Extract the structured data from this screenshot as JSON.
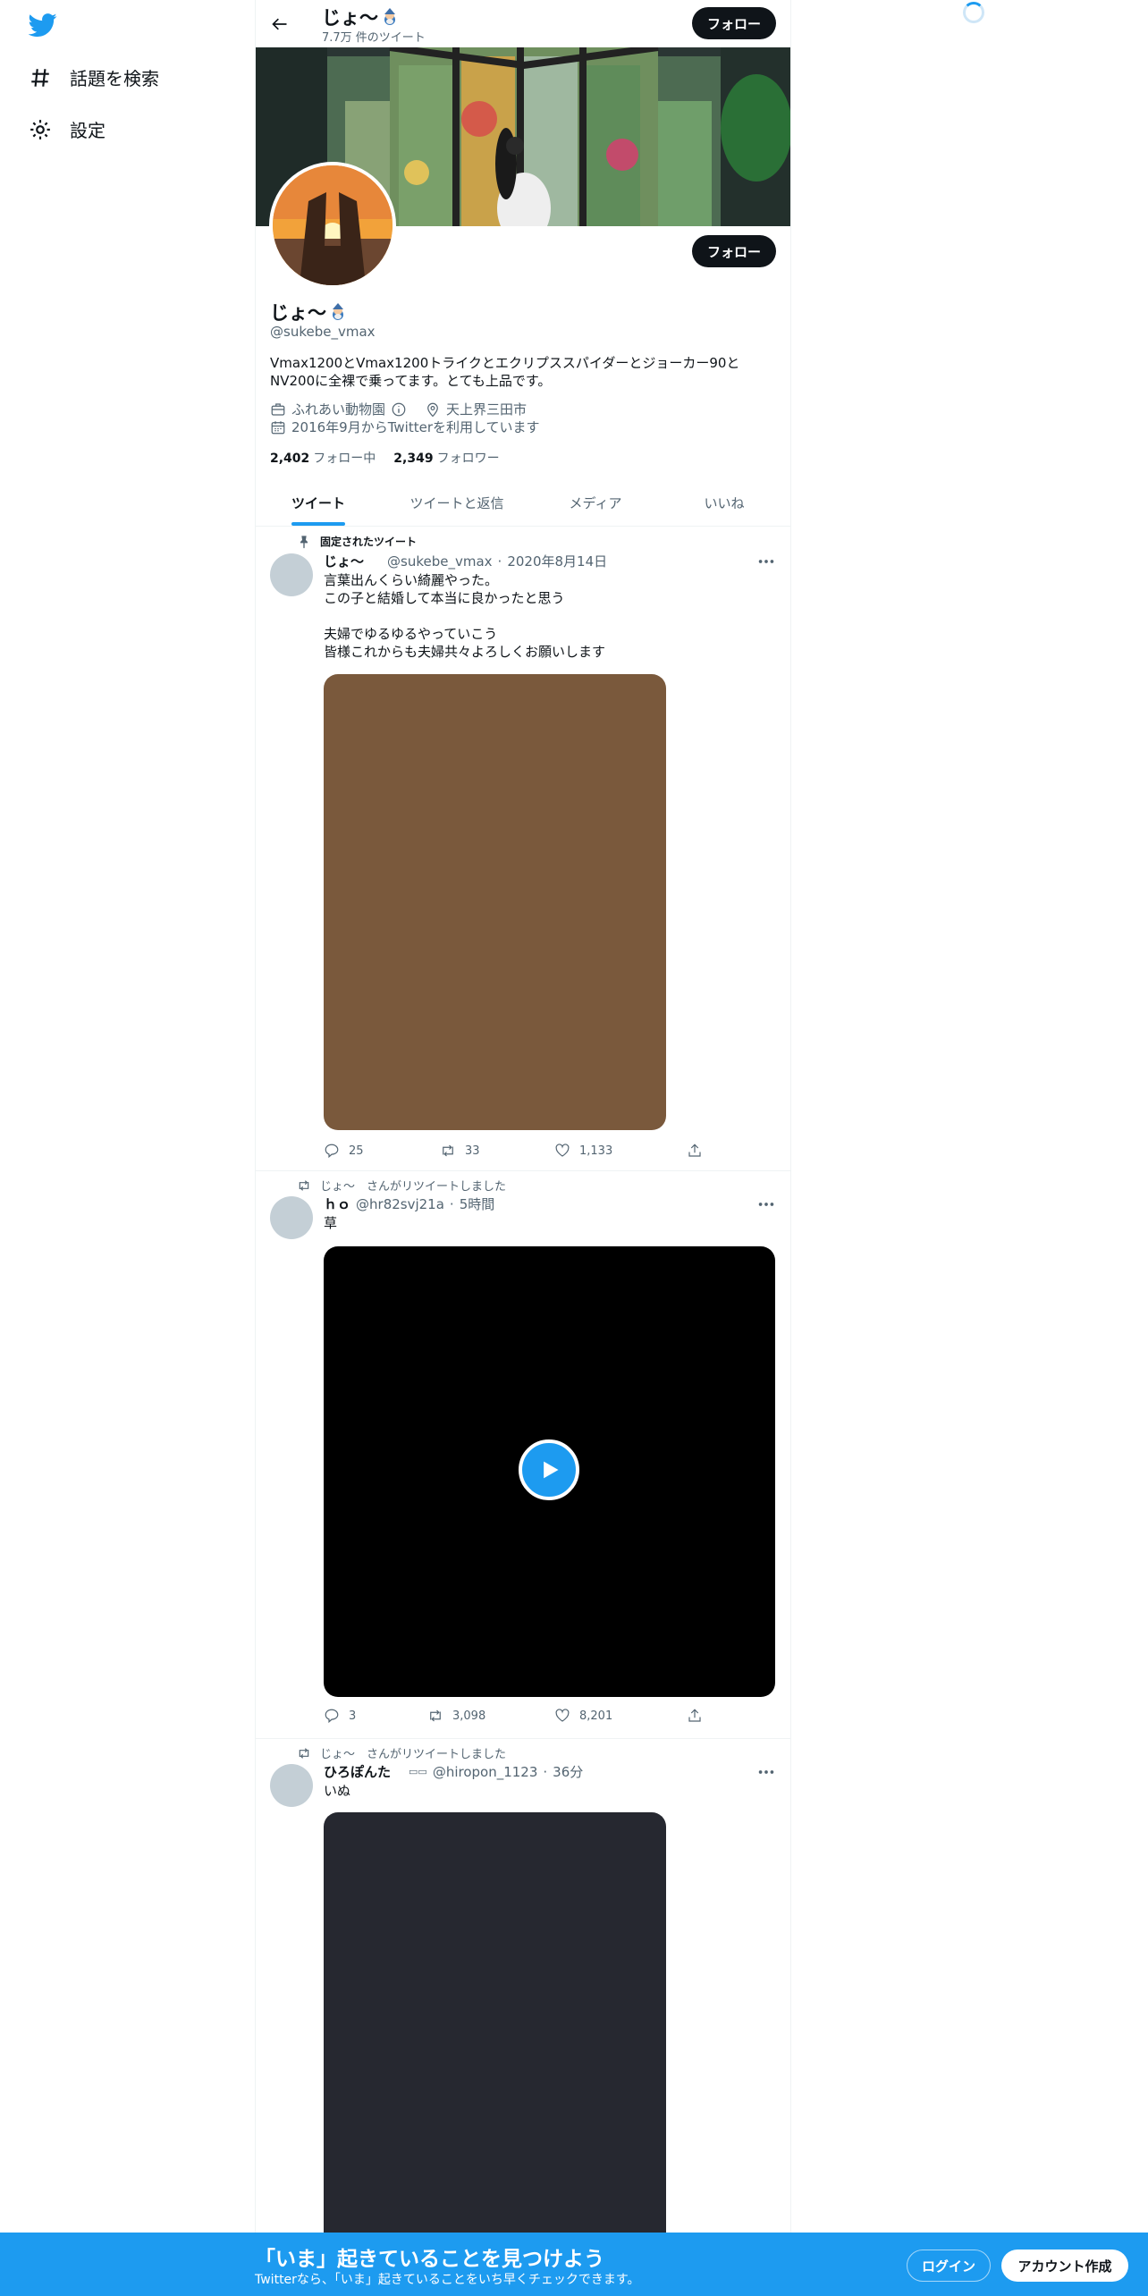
{
  "colors": {
    "accent": "#1d9bf0",
    "text": "#0f1419",
    "secondary": "#536471",
    "follow_button": "#0f1419"
  },
  "nav": {
    "logo": "twitter-bird-icon",
    "items": [
      {
        "label": "話題を検索",
        "icon": "hashtag-icon"
      },
      {
        "label": "設定",
        "icon": "gear-icon"
      }
    ]
  },
  "header": {
    "title": "じょ〜",
    "tweet_count": "7.7万 件のツイート",
    "follow_label": "フォロー"
  },
  "profile": {
    "name": "じょ〜",
    "handle": "@sukebe_vmax",
    "follow_label": "フォロー",
    "bio": "Vmax1200とVmax1200トライクとエクリプススパイダーとジョーカー90とNV200に全裸で乗ってます。とても上品です。",
    "category": "ふれあい動物園",
    "location": "天上界三田市",
    "joined": "2016年9月からTwitterを利用しています",
    "following_count": "2,402",
    "following_label": "フォロー中",
    "followers_count": "2,349",
    "followers_label": "フォロワー"
  },
  "tabs": [
    {
      "label": "ツイート",
      "active": true
    },
    {
      "label": "ツイートと返信",
      "active": false
    },
    {
      "label": "メディア",
      "active": false
    },
    {
      "label": "いいね",
      "active": false
    }
  ],
  "tweets": [
    {
      "context": "固定されたツイート",
      "name": "じょ〜",
      "handle": "@sukebe_vmax",
      "time": "2020年8月14日",
      "text": "言葉出んくらい綺麗やった。\nこの子と結婚して本当に良かったと思う\n\n夫婦でゆるゆるやっていこう\n皆様これからも夫婦共々よろしくお願いします",
      "media_color": "#7a593c",
      "replies": "25",
      "retweets": "33",
      "likes": "1,133"
    },
    {
      "context": "じょ〜　さんがリツイートしました",
      "name": "ｈｏ",
      "handle": "@hr82svj21a",
      "time": "5時間",
      "text": "草",
      "media_color": "#000000",
      "replies": "3",
      "retweets": "3,098",
      "likes": "8,201"
    },
    {
      "context": "じょ〜　さんがリツイートしました",
      "name": "ひろぽんた",
      "handle": "@hiropon_1123",
      "time": "36分",
      "text": "いぬ",
      "media_color": "#262830"
    }
  ],
  "bottom_bar": {
    "title": "「いま」起きていることを見つけよう",
    "subtitle": "Twitterなら、「いま」起きていることをいち早くチェックできます。",
    "login_label": "ログイン",
    "signup_label": "アカウント作成"
  }
}
